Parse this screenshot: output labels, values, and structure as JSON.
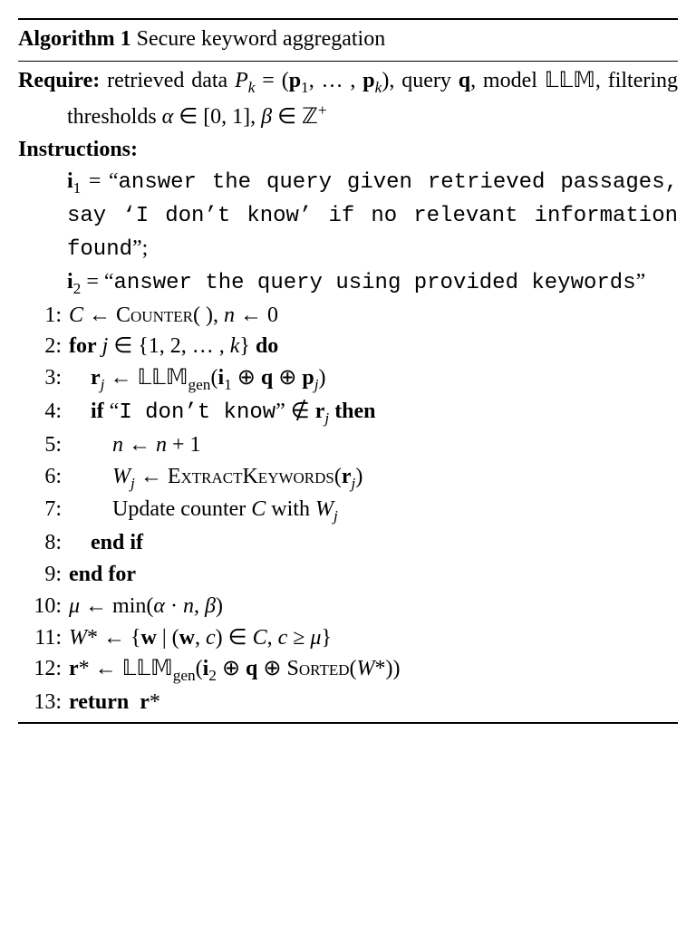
{
  "title_prefix": "Algorithm 1",
  "title_rest": " Secure keyword aggregation",
  "require_label": "Require:",
  "require_html": " retrieved data <span class='cal'>P</span><sub><i>k</i></sub> = (<b>p</b><sub>1</sub>, … , <b>p</b><sub><i>k</i></sub>), query <b>q</b>, model <span class='bb'>𝕃𝕃𝕄</span>, filtering thresholds <i>α</i> ∈ [0, 1], <i>β</i> ∈ <span class='bb'>ℤ</span><sup>+</sup>",
  "instructions_label": "Instructions:",
  "i1_html": "<b>i</b><sub>1</sub> = “<span class='tt'>answer the query given retrieved passages, say ‘I don’t know’ if no relevant information found</span>”;",
  "i2_html": "<b>i</b><sub>2</sub> = “<span class='tt'>answer the query using provided keywords</span>”",
  "steps": [
    {
      "n": "1:",
      "indent": 0,
      "html": "<span class='cal'>C</span> ← <span class='sc'>Counter</span>( ), <i>n</i> ← 0"
    },
    {
      "n": "2:",
      "indent": 0,
      "html": "<span class='kw'>for</span> <i>j</i> ∈ {1, 2, … , <i>k</i>} <span class='kw'>do</span>"
    },
    {
      "n": "3:",
      "indent": 1,
      "html": "<b>r</b><sub><i>j</i></sub> ← <span class='bb'>𝕃𝕃𝕄</span><sub>gen</sub>(<b>i</b><sub>1</sub> ⊕ <b>q</b> ⊕ <b>p</b><sub><i>j</i></sub>)"
    },
    {
      "n": "4:",
      "indent": 1,
      "html": "<span class='kw'>if</span> “<span class='tt'>I don’t know</span>” ∉ <b>r</b><sub><i>j</i></sub> <span class='kw'>then</span>"
    },
    {
      "n": "5:",
      "indent": 2,
      "html": "<i>n</i> ← <i>n</i> + 1"
    },
    {
      "n": "6:",
      "indent": 2,
      "html": "<span class='cal'>W</span><sub><i>j</i></sub> ← <span class='sc'>ExtractKeywords</span>(<b>r</b><sub><i>j</i></sub>)"
    },
    {
      "n": "7:",
      "indent": 2,
      "html": "Update counter <span class='cal'>C</span> with <span class='cal'>W</span><sub><i>j</i></sub>"
    },
    {
      "n": "8:",
      "indent": 1,
      "html": "<span class='kw'>end if</span>"
    },
    {
      "n": "9:",
      "indent": 0,
      "html": "<span class='kw'>end for</span>"
    },
    {
      "n": "10:",
      "indent": 0,
      "html": "<i>μ</i> ← min(<i>α</i> · <i>n</i>, <i>β</i>)"
    },
    {
      "n": "11:",
      "indent": 0,
      "html": "<span class='cal'>W</span>* ← {<b>w</b> | (<b>w</b>, <i>c</i>) ∈ <span class='cal'>C</span>, <i>c</i> ≥ <i>μ</i>}"
    },
    {
      "n": "12:",
      "indent": 0,
      "html": "<b>r</b>* ← <span class='bb'>𝕃𝕃𝕄</span><sub>gen</sub>(<b>i</b><sub>2</sub> ⊕ <b>q</b> ⊕ <span class='sc'>Sorted</span>(<span class='cal'>W</span>*))"
    },
    {
      "n": "13:",
      "indent": 0,
      "html": "<span class='kw'>return</span>&nbsp; <b>r</b>*"
    }
  ]
}
